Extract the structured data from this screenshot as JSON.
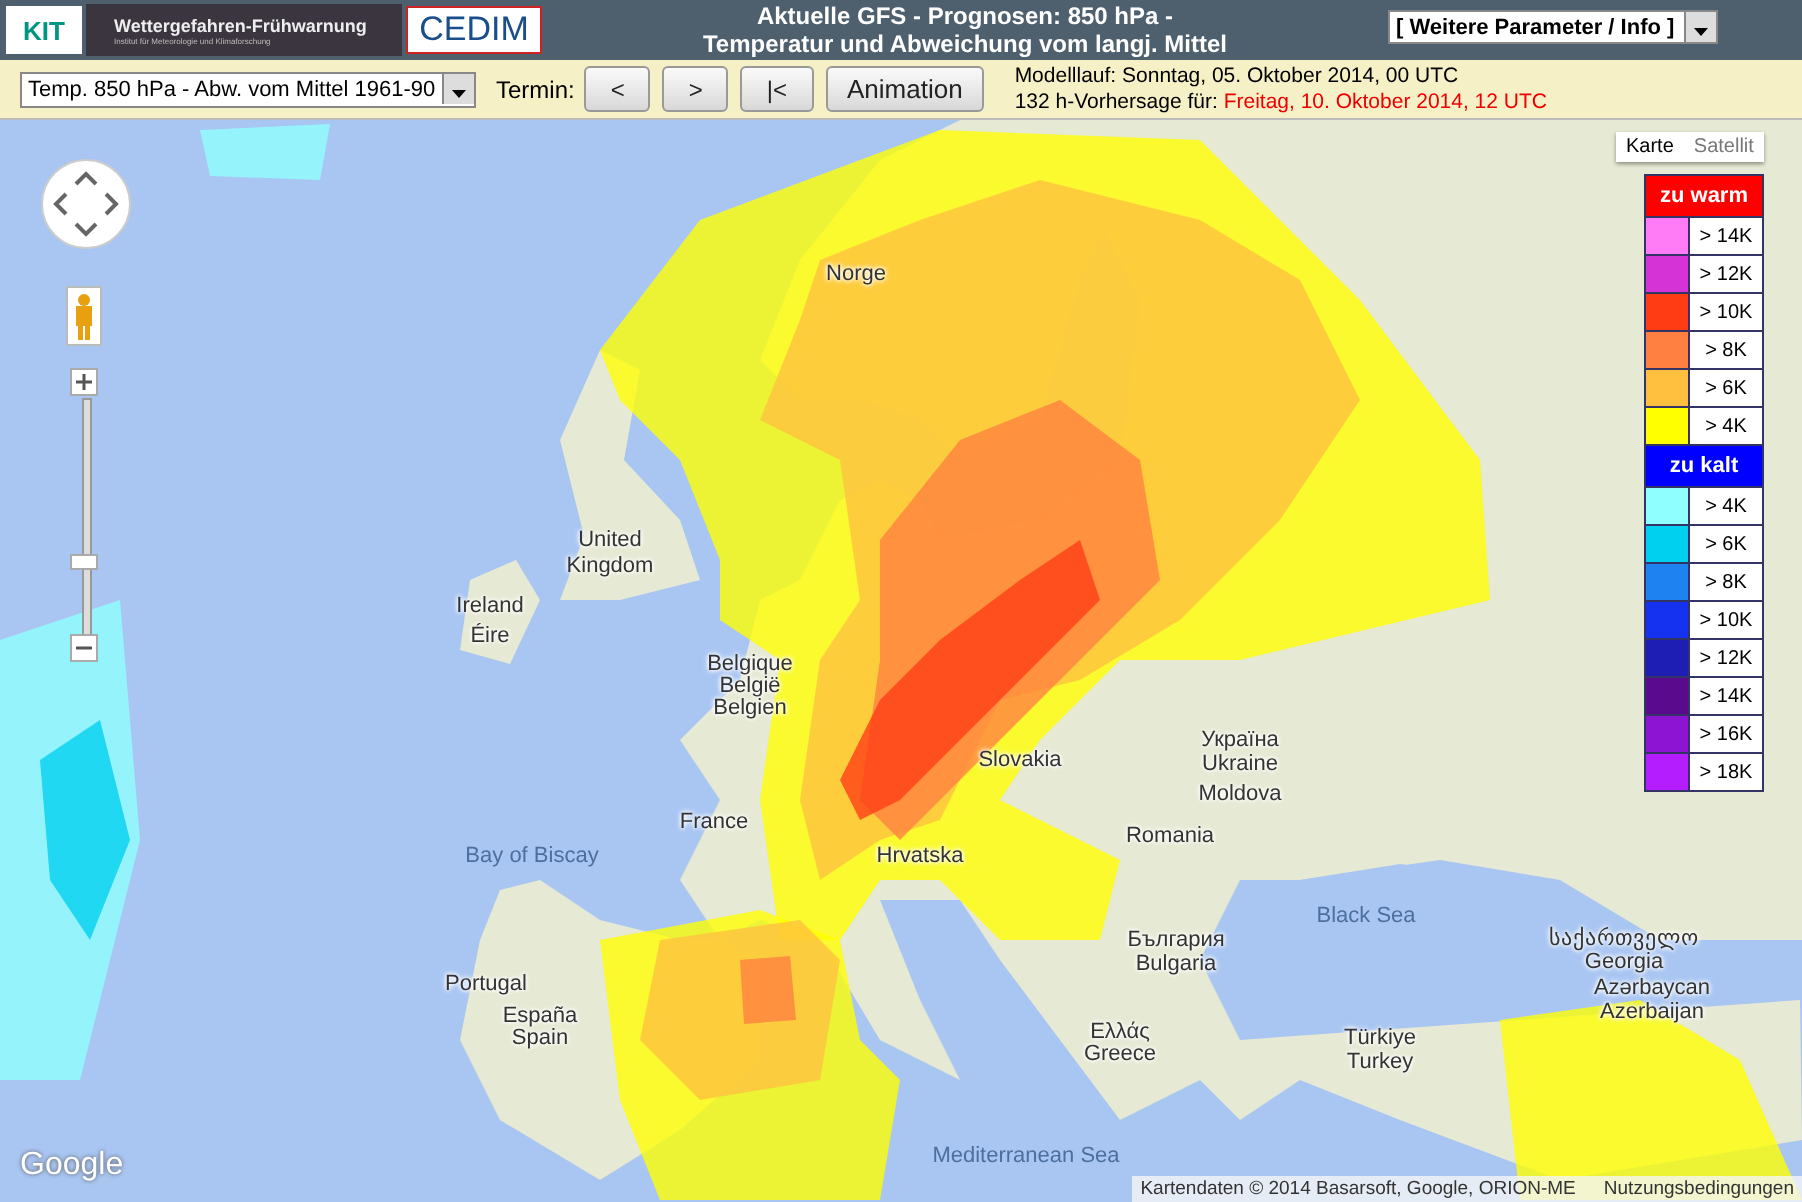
{
  "header": {
    "logos": {
      "kit": "KIT",
      "banner_title": "Wettergefahren-Frühwarnung",
      "banner_subtitle": "Institut für Meteorologie und Klimaforschung",
      "cedim": "CEDIM"
    },
    "title_lines": [
      "Aktuelle GFS - Prognosen: 850 hPa -",
      "Temperatur und Abweichung vom langj. Mittel"
    ],
    "parameter_dropdown": {
      "value": "[ Weitere Parameter / Info ]"
    }
  },
  "toolbar": {
    "field_dropdown": {
      "value": "Temp. 850 hPa - Abw. vom Mittel 1961-90"
    },
    "termin_label": "Termin:",
    "buttons": [
      "<",
      ">",
      "|<",
      "Animation"
    ],
    "model_run": "Modelllauf: Sonntag, 05. Oktober 2014, 00 UTC",
    "forecast_label": "132 h-Vorhersage für:",
    "forecast_time": "Freitag, 10. Oktober 2014, 12 UTC"
  },
  "map": {
    "map_types": [
      {
        "label": "Karte",
        "selected": true
      },
      {
        "label": "Satellit",
        "selected": false
      }
    ],
    "legend": [
      {
        "title": "zu warm",
        "color": "#ff0000",
        "items": [
          {
            "label": "> 14K",
            "color": "#ff7cf6"
          },
          {
            "label": "> 12K",
            "color": "#d633d6"
          },
          {
            "label": "> 10K",
            "color": "#ff3c14"
          },
          {
            "label": "> 8K",
            "color": "#ff8040"
          },
          {
            "label": "> 6K",
            "color": "#ffc040"
          },
          {
            "label": "> 4K",
            "color": "#ffff00"
          }
        ]
      },
      {
        "title": "zu kalt",
        "color": "#0000ff",
        "items": [
          {
            "label": "> 4K",
            "color": "#90ffff"
          },
          {
            "label": "> 6K",
            "color": "#00d0f0"
          },
          {
            "label": "> 8K",
            "color": "#1e82f0"
          },
          {
            "label": "> 10K",
            "color": "#1432f0"
          },
          {
            "label": "> 12K",
            "color": "#1e1eb4"
          },
          {
            "label": "> 14K",
            "color": "#5a0a8c"
          },
          {
            "label": "> 16K",
            "color": "#8c14d2"
          },
          {
            "label": "> 18K",
            "color": "#b41eff"
          }
        ]
      }
    ],
    "labels": [
      {
        "text": "Norge",
        "kind": "country"
      },
      {
        "text": "United",
        "kind": "country"
      },
      {
        "text": "Kingdom",
        "kind": "country"
      },
      {
        "text": "Ireland",
        "kind": "country"
      },
      {
        "text": "Éire",
        "kind": "country"
      },
      {
        "text": "Belgique",
        "kind": "country"
      },
      {
        "text": "België",
        "kind": "country"
      },
      {
        "text": "Belgien",
        "kind": "country"
      },
      {
        "text": "France",
        "kind": "country"
      },
      {
        "text": "Bay of Biscay",
        "kind": "sea"
      },
      {
        "text": "Portugal",
        "kind": "country"
      },
      {
        "text": "España",
        "kind": "country"
      },
      {
        "text": "Spain",
        "kind": "country"
      },
      {
        "text": "Slovakia",
        "kind": "country"
      },
      {
        "text": "Україна",
        "kind": "country"
      },
      {
        "text": "Ukraine",
        "kind": "country"
      },
      {
        "text": "Moldova",
        "kind": "country"
      },
      {
        "text": "Romania",
        "kind": "country"
      },
      {
        "text": "Hrvatska",
        "kind": "country"
      },
      {
        "text": "България",
        "kind": "country"
      },
      {
        "text": "Bulgaria",
        "kind": "country"
      },
      {
        "text": "Black Sea",
        "kind": "sea"
      },
      {
        "text": "საქართველო",
        "kind": "country"
      },
      {
        "text": "Georgia",
        "kind": "country"
      },
      {
        "text": "Azərbaycan",
        "kind": "country"
      },
      {
        "text": "Azerbaijan",
        "kind": "country"
      },
      {
        "text": "Ελλάς",
        "kind": "country"
      },
      {
        "text": "Greece",
        "kind": "country"
      },
      {
        "text": "Türkiye",
        "kind": "country"
      },
      {
        "text": "Turkey",
        "kind": "country"
      },
      {
        "text": "Mediterranean Sea",
        "kind": "sea"
      }
    ],
    "google_logo": "Google",
    "attribution": "Kartendaten © 2014 Basarsoft, Google, ORION-ME",
    "terms_link": "Nutzungsbedingungen"
  }
}
